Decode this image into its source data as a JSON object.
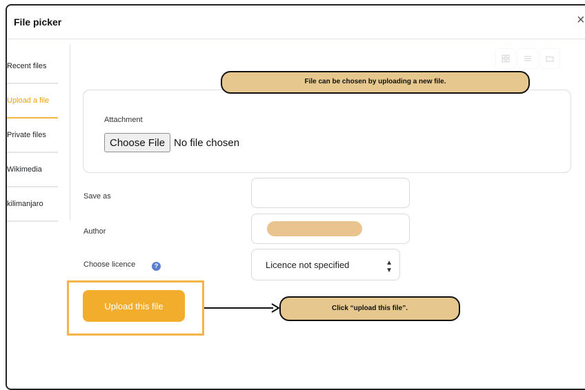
{
  "dialog": {
    "title": "File picker",
    "close_glyph": "×"
  },
  "sidebar": {
    "items": [
      {
        "label": "Recent files",
        "active": false
      },
      {
        "label": "Upload a file",
        "active": true
      },
      {
        "label": "Private files",
        "active": false
      },
      {
        "label": "Wikimedia",
        "active": false
      },
      {
        "label": "kilimanjaro",
        "active": false
      }
    ]
  },
  "view_buttons": [
    "grid-view-icon",
    "list-view-icon",
    "folder-view-icon"
  ],
  "callouts": {
    "top": "File can be chosen by uploading a new file.",
    "bottom": "Click “upload this file”."
  },
  "form": {
    "attachment_label": "Attachment",
    "choose_file_label": "Choose File",
    "no_file_text": "No file chosen",
    "save_as_label": "Save as",
    "save_as_value": "",
    "author_label": "Author",
    "licence_label": "Choose licence",
    "licence_value": "Licence not specified",
    "help_glyph": "?",
    "upload_button": "Upload this file"
  },
  "colors": {
    "accent": "#f2ad2c",
    "callout_fill": "#e6c78e",
    "highlight_border": "#f5b44a",
    "help_icon": "#5b7fd0"
  }
}
